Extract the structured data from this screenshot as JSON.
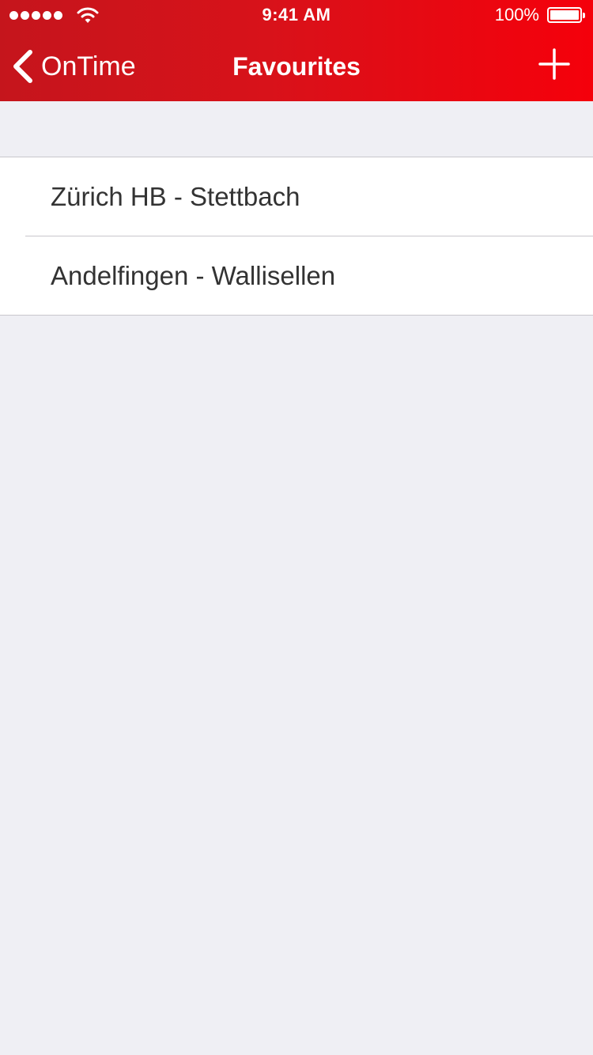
{
  "status_bar": {
    "time": "9:41 AM",
    "battery_percent": "100%",
    "signal_dots": 5,
    "icons": [
      "signal-dots-icon",
      "wifi-icon",
      "battery-icon"
    ]
  },
  "nav": {
    "back_label": "OnTime",
    "title": "Favourites",
    "icons": [
      "chevron-left-icon",
      "plus-icon"
    ]
  },
  "favourites": [
    {
      "label": "Zürich HB - Stettbach"
    },
    {
      "label": "Andelfingen - Wallisellen"
    }
  ],
  "colors": {
    "header_start": "#c5151c",
    "header_end": "#f5000b",
    "background": "#efeff4",
    "cell": "#ffffff",
    "text": "#333333"
  }
}
